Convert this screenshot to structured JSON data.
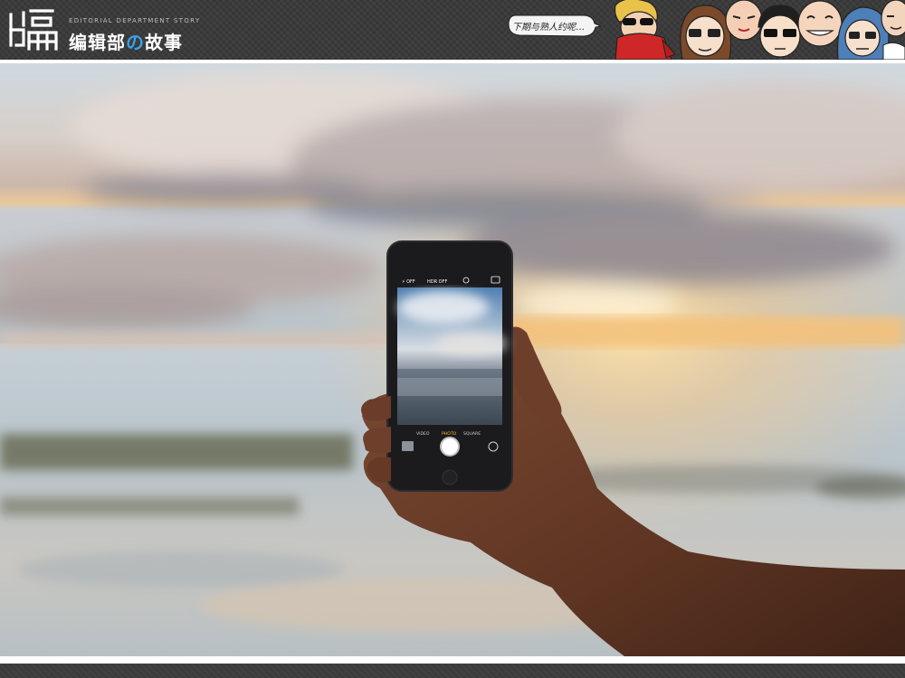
{
  "header": {
    "logo_glyph": "编",
    "logo_subtitle": "EDITORIAL DEPARTMENT STORY",
    "logo_title_part1": "编辑部",
    "logo_title_accent": "の",
    "logo_title_part2": "故事",
    "speech_bubble": "下期与熟人约呢…",
    "characters_icon": "cartoon-editor-faces"
  },
  "photo": {
    "subject": "hand-holding-phone-at-beach-sunset",
    "phone_screen": {
      "top_flash": "⚡ OFF",
      "top_hdr": "HDR OFF",
      "modes": [
        "VIDEO",
        "PHOTO",
        "SQUARE"
      ],
      "active_mode": "PHOTO"
    }
  },
  "colors": {
    "header_bg": "#3b3b3b",
    "accent": "#3aa0e8"
  }
}
